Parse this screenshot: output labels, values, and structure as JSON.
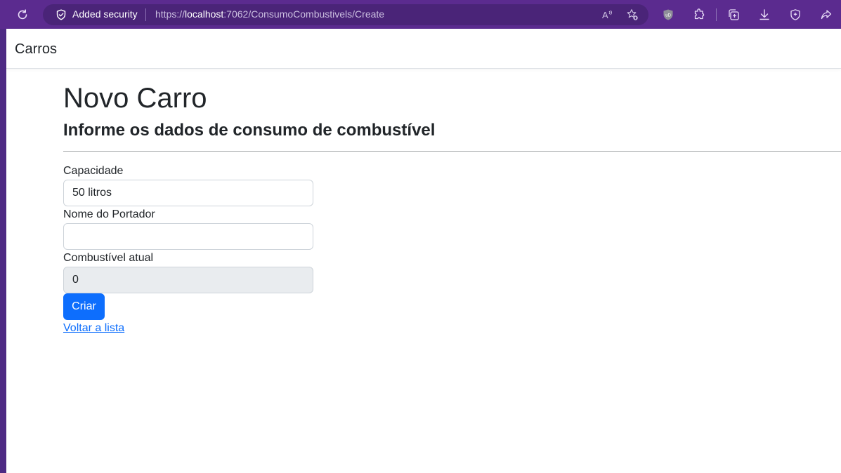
{
  "browser": {
    "security_label": "Added security",
    "url_prefix": "https://",
    "url_host": "localhost",
    "url_rest": ":7062/ConsumoCombustivels/Create",
    "icons": [
      "reload-icon",
      "shield-check-icon",
      "read-aloud-icon",
      "favorite-add-icon",
      "ublock-icon",
      "extensions-icon",
      "collections-icon",
      "downloads-icon",
      "browser-essentials-icon",
      "share-icon"
    ]
  },
  "navbar": {
    "brand": "Carros"
  },
  "main": {
    "title": "Novo Carro",
    "subtitle": "Informe os dados de consumo de combustível"
  },
  "form": {
    "capacidade": {
      "label": "Capacidade",
      "value": "50 litros"
    },
    "nome_portador": {
      "label": "Nome do Portador",
      "value": ""
    },
    "combustivel_atual": {
      "label": "Combustível atual",
      "value": "0"
    },
    "submit_label": "Criar",
    "back_link": "Voltar a lista"
  },
  "colors": {
    "browser_chrome": "#5b2b8f",
    "primary": "#0d6efd",
    "readonly_bg": "#e9ecef"
  }
}
